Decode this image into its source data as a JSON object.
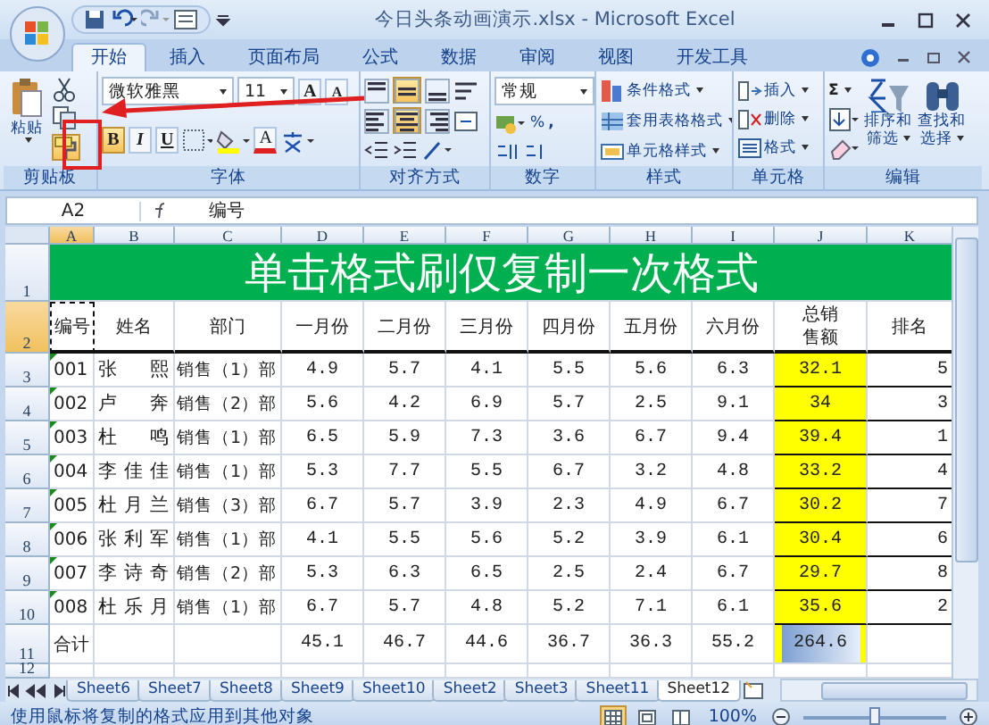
{
  "window": {
    "title": "今日头条动画演示.xlsx - Microsoft Excel"
  },
  "tabs": [
    {
      "label": "开始",
      "selected": true
    },
    {
      "label": "插入",
      "selected": false
    },
    {
      "label": "页面布局",
      "selected": false
    },
    {
      "label": "公式",
      "selected": false
    },
    {
      "label": "数据",
      "selected": false
    },
    {
      "label": "审阅",
      "selected": false
    },
    {
      "label": "视图",
      "selected": false
    },
    {
      "label": "开发工具",
      "selected": false
    }
  ],
  "ribbon": {
    "clipboard": {
      "label": "剪贴板",
      "paste": "粘贴",
      "format_painter": {
        "selected": true
      }
    },
    "font": {
      "label": "字体",
      "name": "微软雅黑",
      "size": "11",
      "grow": "A",
      "shrink": "A",
      "bold": {
        "label": "B",
        "selected": true
      },
      "italic": {
        "label": "I",
        "selected": false
      },
      "underline": {
        "label": "U",
        "selected": false
      },
      "font_color_button": "A"
    },
    "alignment": {
      "label": "对齐方式",
      "vertical": [
        {
          "selected": false
        },
        {
          "selected": true
        },
        {
          "selected": false
        }
      ],
      "horizontal": [
        {
          "selected": false
        },
        {
          "selected": true
        },
        {
          "selected": false
        }
      ]
    },
    "number": {
      "label": "数字",
      "format": "常规",
      "percent": "%",
      "comma": ","
    },
    "styles": {
      "label": "样式",
      "items": [
        "条件格式",
        "套用表格格式",
        "单元格样式"
      ]
    },
    "cells": {
      "label": "单元格",
      "items": [
        "插入",
        "删除",
        "格式"
      ]
    },
    "editing": {
      "label": "编辑",
      "sum": "Σ",
      "sort": [
        "排序和",
        "筛选"
      ],
      "find": [
        "查找和",
        "选择"
      ]
    }
  },
  "formula_bar": {
    "name_box": "A2",
    "value": "编号"
  },
  "columns": [
    {
      "label": "A",
      "selected": true
    },
    {
      "label": "B",
      "selected": false
    },
    {
      "label": "C",
      "selected": false
    },
    {
      "label": "D",
      "selected": false
    },
    {
      "label": "E",
      "selected": false
    },
    {
      "label": "F",
      "selected": false
    },
    {
      "label": "G",
      "selected": false
    },
    {
      "label": "H",
      "selected": false
    },
    {
      "label": "I",
      "selected": false
    },
    {
      "label": "J",
      "selected": false
    },
    {
      "label": "K",
      "selected": false
    }
  ],
  "rows": [
    {
      "kind": "title",
      "number": "1",
      "selected": false,
      "text": "单击格式刷仅复制一次格式"
    },
    {
      "kind": "header",
      "number": "2",
      "selected": true,
      "cells": [
        {
          "text": "编号",
          "selected": true
        },
        {
          "text": "姓名",
          "selected": false
        },
        {
          "text": "部门",
          "selected": false
        },
        {
          "text": "一月份",
          "selected": false
        },
        {
          "text": "二月份",
          "selected": false
        },
        {
          "text": "三月份",
          "selected": false
        },
        {
          "text": "四月份",
          "selected": false
        },
        {
          "text": "五月份",
          "selected": false
        },
        {
          "text": "六月份",
          "selected": false
        },
        {
          "text": "总销售额",
          "selected": false
        },
        {
          "text": "排名",
          "selected": false
        }
      ]
    },
    {
      "kind": "data",
      "number": "3",
      "selected": false,
      "flagged": true,
      "id": "001",
      "name": "张 熙",
      "dept": "销售（1）部",
      "months": [
        "4.9",
        "5.7",
        "4.1",
        "5.5",
        "5.6",
        "6.3"
      ],
      "total": "32.1",
      "rank": "5"
    },
    {
      "kind": "data",
      "number": "4",
      "selected": false,
      "flagged": true,
      "id": "002",
      "name": "卢 奔",
      "dept": "销售（2）部",
      "months": [
        "5.6",
        "4.2",
        "6.9",
        "5.7",
        "2.5",
        "9.1"
      ],
      "total": "34",
      "rank": "3"
    },
    {
      "kind": "data",
      "number": "5",
      "selected": false,
      "flagged": true,
      "id": "003",
      "name": "杜 鸣",
      "dept": "销售（1）部",
      "months": [
        "6.5",
        "5.9",
        "7.3",
        "3.6",
        "6.7",
        "9.4"
      ],
      "total": "39.4",
      "rank": "1"
    },
    {
      "kind": "data",
      "number": "6",
      "selected": false,
      "flagged": true,
      "id": "004",
      "name": "李 佳 佳",
      "dept": "销售（1）部",
      "months": [
        "5.3",
        "7.7",
        "5.5",
        "6.7",
        "3.2",
        "4.8"
      ],
      "total": "33.2",
      "rank": "4"
    },
    {
      "kind": "data",
      "number": "7",
      "selected": false,
      "flagged": true,
      "id": "005",
      "name": "杜 月 兰",
      "dept": "销售（3）部",
      "months": [
        "6.7",
        "5.7",
        "3.9",
        "2.3",
        "4.9",
        "6.7"
      ],
      "total": "30.2",
      "rank": "7"
    },
    {
      "kind": "data",
      "number": "8",
      "selected": false,
      "flagged": true,
      "id": "006",
      "name": "张 利 军",
      "dept": "销售（1）部",
      "months": [
        "4.1",
        "5.5",
        "5.6",
        "5.2",
        "3.9",
        "6.1"
      ],
      "total": "30.4",
      "rank": "6"
    },
    {
      "kind": "data",
      "number": "9",
      "selected": false,
      "flagged": true,
      "id": "007",
      "name": "李 诗 奇",
      "dept": "销售（2）部",
      "months": [
        "5.3",
        "6.3",
        "6.5",
        "2.5",
        "2.4",
        "6.7"
      ],
      "total": "29.7",
      "rank": "8"
    },
    {
      "kind": "data",
      "number": "10",
      "selected": false,
      "flagged": true,
      "id": "008",
      "name": "杜 乐 月",
      "dept": "销售（1）部",
      "months": [
        "6.7",
        "5.7",
        "4.8",
        "5.2",
        "7.1",
        "6.1"
      ],
      "total": "35.6",
      "rank": "2"
    },
    {
      "kind": "total",
      "number": "11",
      "selected": false,
      "label": "合计",
      "months": [
        "45.1",
        "46.7",
        "44.6",
        "36.7",
        "36.3",
        "55.2"
      ],
      "total": "264.6",
      "total_selected": true
    },
    {
      "kind": "blank",
      "number": "12",
      "selected": false
    }
  ],
  "sheet_tabs": [
    {
      "label": "Sheet6",
      "selected": false
    },
    {
      "label": "Sheet7",
      "selected": false
    },
    {
      "label": "Sheet8",
      "selected": false
    },
    {
      "label": "Sheet9",
      "selected": false
    },
    {
      "label": "Sheet10",
      "selected": false
    },
    {
      "label": "Sheet2",
      "selected": false
    },
    {
      "label": "Sheet3",
      "selected": false
    },
    {
      "label": "Sheet11",
      "selected": false
    },
    {
      "label": "Sheet12",
      "selected": true
    }
  ],
  "status_bar": {
    "message": "使用鼠标将复制的格式应用到其他对象",
    "views": [
      {
        "selected": true
      },
      {
        "selected": false
      },
      {
        "selected": false
      }
    ],
    "zoom": "100%",
    "zoom_slider": {
      "level": 0.5
    }
  }
}
